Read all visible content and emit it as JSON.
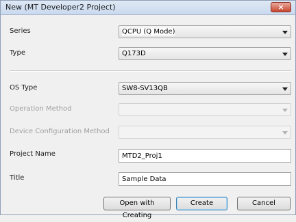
{
  "window": {
    "title": "New (MT Developer2 Project)",
    "close_icon": "×"
  },
  "form": {
    "series": {
      "label": "Series",
      "value": "QCPU (Q Mode)"
    },
    "type": {
      "label": "Type",
      "value": "Q173D"
    },
    "os_type": {
      "label": "OS Type",
      "value": "SW8-SV13QB"
    },
    "operation_method": {
      "label": "Operation Method",
      "value": ""
    },
    "device_configuration_method": {
      "label": "Device Configuration Method",
      "value": ""
    },
    "project_name": {
      "label": "Project Name",
      "value": "MTD2_Proj1"
    },
    "title": {
      "label": "Title",
      "value": "Sample Data"
    }
  },
  "buttons": {
    "open_with_creating": "Open with Creating",
    "create": "Create",
    "cancel": "Cancel"
  }
}
